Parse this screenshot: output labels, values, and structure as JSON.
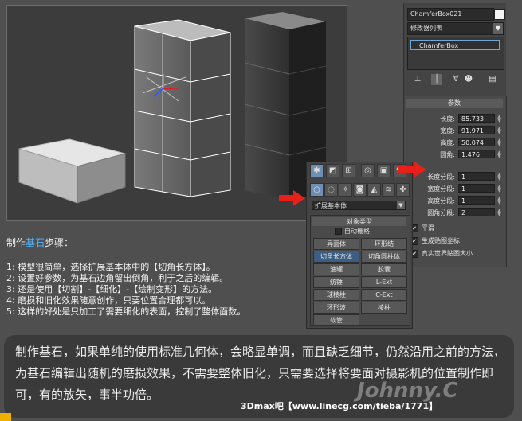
{
  "command_panel": {
    "object_name": "ChamferBox021",
    "modifier_list": "修改器列表",
    "stack_item": "ChamferBox"
  },
  "params": {
    "title": "参数",
    "fields": [
      {
        "label": "长度:",
        "value": "85.733"
      },
      {
        "label": "宽度:",
        "value": "91.971"
      },
      {
        "label": "高度:",
        "value": "50.074"
      },
      {
        "label": "圆角:",
        "value": "1.476"
      },
      {
        "label": "长度分段:",
        "value": "1"
      },
      {
        "label": "宽度分段:",
        "value": "1"
      },
      {
        "label": "高度分段:",
        "value": "1"
      },
      {
        "label": "圆角分段:",
        "value": "2"
      }
    ],
    "checks": [
      {
        "label": "平滑",
        "checked": true
      },
      {
        "label": "生成贴图坐标",
        "checked": true
      },
      {
        "label": "真实世界贴图大小",
        "checked": true
      }
    ]
  },
  "create_panel": {
    "type_select": "扩展基本体",
    "object_type_title": "对象类型",
    "auto_grid": "自动栅格",
    "buttons": [
      "异面体",
      "环形结",
      "切角长方体",
      "切角圆柱体",
      "油罐",
      "胶囊",
      "纺锤",
      "L-Ext",
      "球棱柱",
      "C-Ext",
      "环形波",
      "棱柱",
      "软管"
    ]
  },
  "steps": {
    "title_pre": "制作",
    "title_hi": "基石",
    "title_post": "步骤：",
    "items": [
      "1: 模型很简单，选择扩展基本体中的【切角长方体】。",
      "2: 设置好参数，为基石边角留出倒角，利于之后的编辑。",
      "3: 还是使用【切割】-【细化】-【绘制变形】的方法。",
      "4: 磨损和旧化效果随意创作，只要位置合理都可以。",
      "5: 这样的好处是只加工了需要细化的表面，控制了整体面数。"
    ]
  },
  "caption": {
    "text": "制作基石，如果单纯的使用标准几何体，会略显单调，而且缺乏细节，仍然沿用之前的方法，为基石编辑出随机的磨损效果，不需要整体旧化，只需要选择将要面对摄影机的位置制作即可，有的放矢，事半功倍。"
  },
  "watermark": "Johnny.C",
  "site": "3Dmax吧【www.linecg.com/tieba/1771】",
  "colors": {
    "accent_blue": "#52b7ff",
    "arrow_red": "#e8201a",
    "selected_button": "#3d5e82"
  }
}
